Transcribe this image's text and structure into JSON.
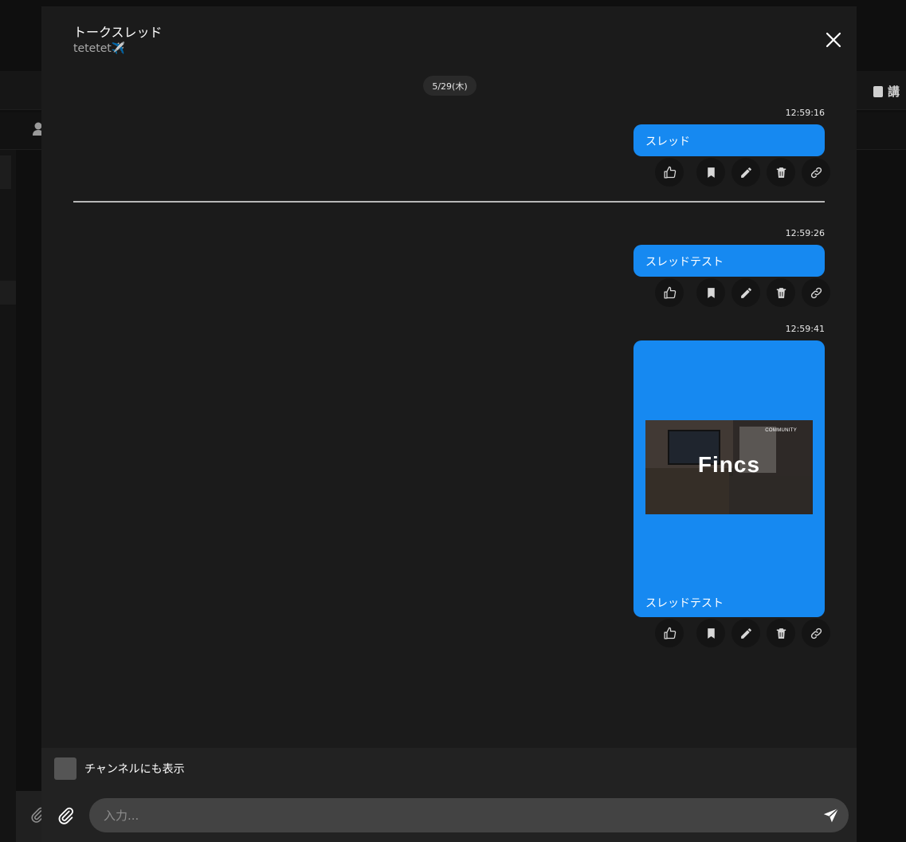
{
  "background": {
    "right_label": "講"
  },
  "thread": {
    "title": "トークスレッド",
    "subtitle": "tetetet✈️",
    "date_label": "5/29(木)"
  },
  "messages": [
    {
      "time": "12:59:16",
      "text": "スレッド"
    },
    {
      "time": "12:59:26",
      "text": "スレッドテスト"
    },
    {
      "time": "12:59:41",
      "text": "スレッドテスト",
      "image": {
        "logo_text": "Fincs",
        "corner_text": "COMMUNITY"
      }
    }
  ],
  "message_actions": [
    "like-icon",
    "bookmark-icon",
    "edit-icon",
    "delete-icon",
    "link-icon"
  ],
  "composer": {
    "also_channel_label": "チャンネルにも表示",
    "placeholder": "入力..."
  },
  "colors": {
    "bubble": "#1689f1",
    "modal_bg": "#1b1b1b",
    "composer_bg": "#222222"
  }
}
